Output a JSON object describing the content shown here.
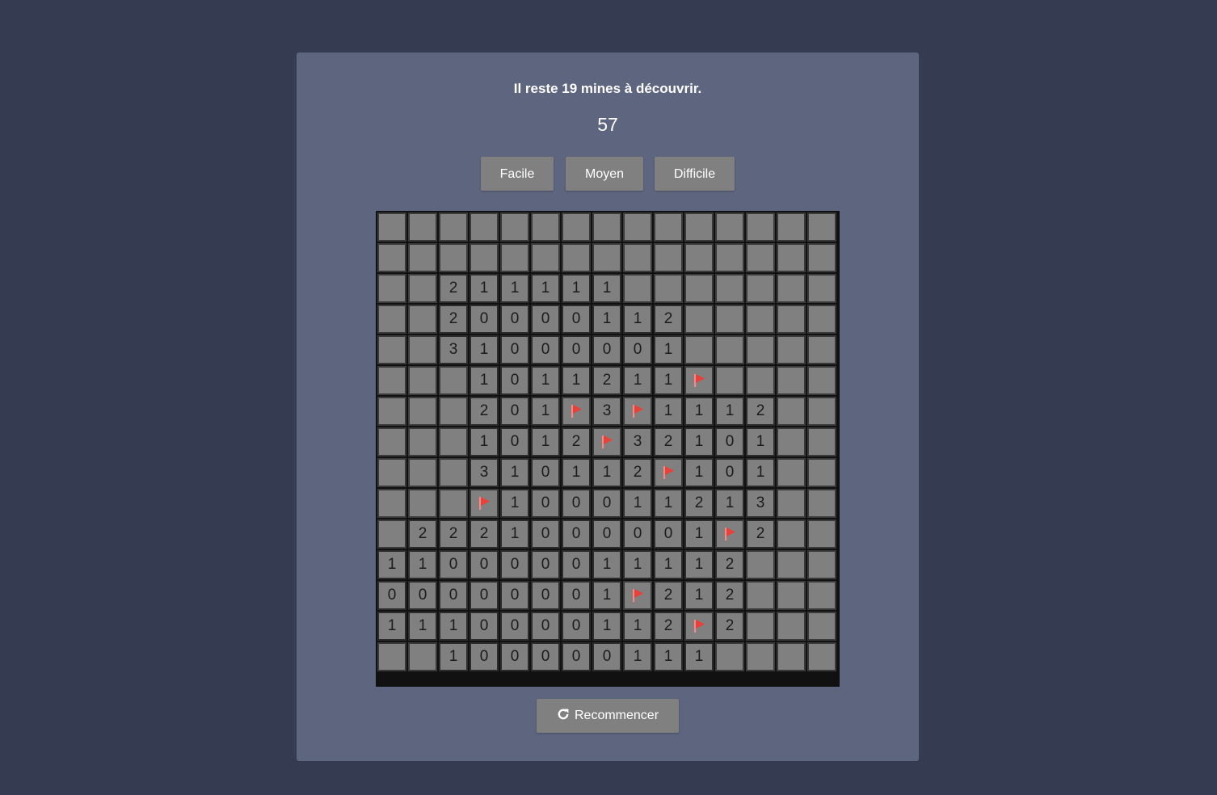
{
  "header": {
    "status_text": "Il reste 19 mines à découvrir.",
    "timer": "57"
  },
  "difficulty": {
    "easy_label": "Facile",
    "medium_label": "Moyen",
    "hard_label": "Difficile"
  },
  "restart": {
    "label": "Recommencer",
    "icon": "refresh-icon"
  },
  "colors": {
    "background": "#353c52",
    "panel": "#5e667f",
    "cell": "#808080",
    "flag": "#e8413a"
  },
  "board": {
    "rows": 15,
    "cols": 15,
    "legend": "U = unrevealed, F = flag, digit = revealed count",
    "grid": [
      "UUUUUUUUUUUUUUU",
      "UUUUUUUUUUUUUUU",
      "UU211111UUUUUUU",
      "UU20000112UUUUU",
      "UU31000001UUUUU",
      "UUU1011211FUUUU",
      "UUU201F3F1112UU",
      "UUU1012F32101UU",
      "UUU310112F101UU",
      "UUUF100011213UU",
      "U2221000001F2UU",
      "110000011112UUU",
      "0000000 1F212UUU",
      "1110000112F2UUU",
      "UU100000111UUUU"
    ]
  }
}
